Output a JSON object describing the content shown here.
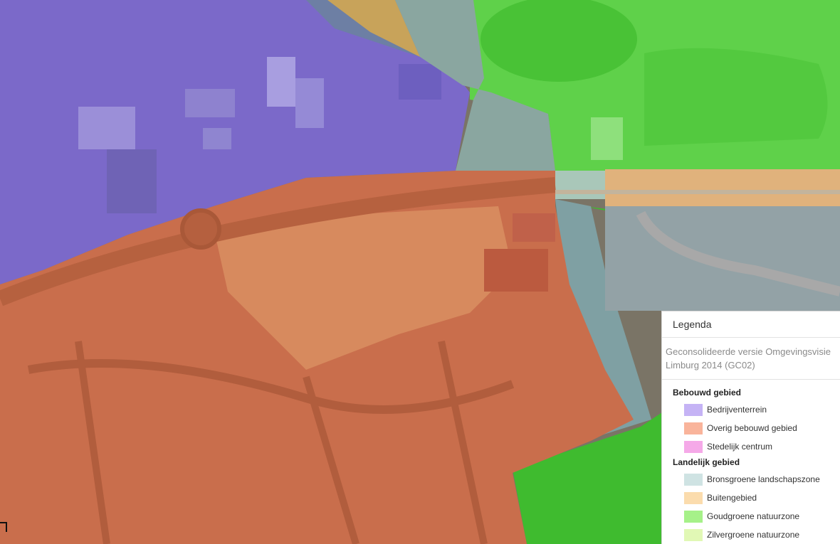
{
  "legend": {
    "title": "Legenda",
    "source": "Geconsolideerde versie Omgevingsvisie Limburg 2014 (GC02)",
    "groups": [
      {
        "title": "Bebouwd gebied",
        "items": [
          {
            "label": "Bedrijventerrein",
            "color": "#c5b3f5"
          },
          {
            "label": "Overig bebouwd gebied",
            "color": "#f9b49b"
          },
          {
            "label": "Stedelijk centrum",
            "color": "#f5a9e8"
          }
        ]
      },
      {
        "title": "Landelijk gebied",
        "items": [
          {
            "label": "Bronsgroene landschapszone",
            "color": "#cfe3e3"
          },
          {
            "label": "Buitengebied",
            "color": "#fbdcad"
          },
          {
            "label": "Goudgroene natuurzone",
            "color": "#a6f189"
          },
          {
            "label": "Zilvergroene natuurzone",
            "color": "#e1f8b5"
          }
        ]
      }
    ]
  },
  "map_colors": {
    "bedrijventerrein": "#7d63c7",
    "overig_bebouwd": "#d2734f",
    "bronsgroen": "#7fa6a8",
    "buitengebied": "#d9a95a",
    "goudgroen": "#4dc43a"
  }
}
